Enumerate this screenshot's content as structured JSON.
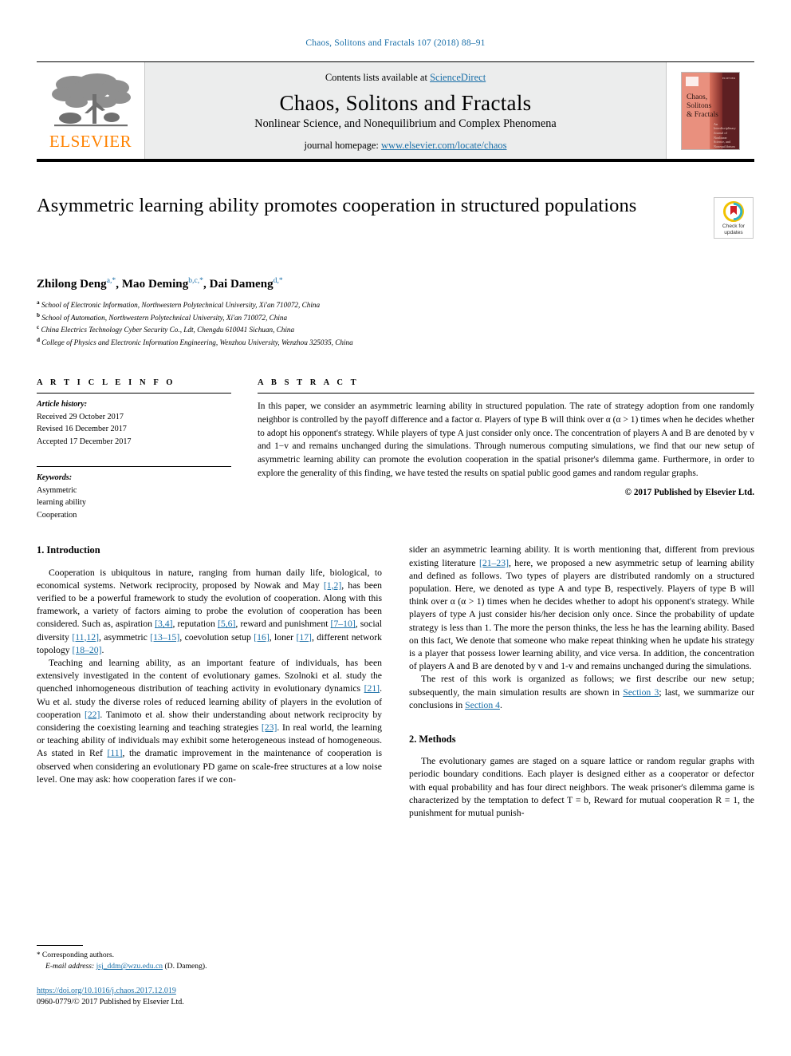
{
  "running_head": "Chaos, Solitons and Fractals 107 (2018) 88–91",
  "masthead": {
    "publisher_name": "ELSEVIER",
    "contents_prefix": "Contents lists available at ",
    "sciencedirect": "ScienceDirect",
    "journal_title": "Chaos, Solitons and Fractals",
    "journal_subtitle": "Nonlinear Science, and Nonequilibrium and Complex Phenomena",
    "homepage_prefix": "journal homepage: ",
    "homepage_url": "www.elsevier.com/locate/chaos",
    "cover": {
      "title_line1": "Chaos,",
      "title_line2": "Solitons",
      "title_line3": "& Fractals",
      "subtitle": "An Interdisciplinary Journal of Nonlinear Science, and Nonequilibrium and Complex Phenomena",
      "corner_label": "ELSEVIER"
    }
  },
  "article": {
    "title": "Asymmetric learning ability promotes cooperation in structured populations",
    "crossmark_line1": "Check for",
    "crossmark_line2": "updates",
    "authors": [
      {
        "name": "Zhilong Deng",
        "marks": "a,",
        "star": "*"
      },
      {
        "name": "Mao Deming",
        "marks": "b,c,",
        "star": "*"
      },
      {
        "name": "Dai Dameng",
        "marks": "d,",
        "star": "*"
      }
    ],
    "affiliations": [
      {
        "mark": "a",
        "text": "School of Electronic Information, Northwestern Polytechnical University, Xi'an 710072, China"
      },
      {
        "mark": "b",
        "text": "School of Automation, Northwestern Polytechnical University, Xi'an 710072, China"
      },
      {
        "mark": "c",
        "text": "China Electrics Technology Cyber Security Co., Ldt, Chengdu 610041 Sichuan, China"
      },
      {
        "mark": "d",
        "text": "College of Physics and Electronic Information Engineering, Wenzhou University, Wenzhou 325035, China"
      }
    ]
  },
  "article_info": {
    "heading": "A R T I C L E   I N F O",
    "history_label": "Article history:",
    "history": [
      "Received 29 October 2017",
      "Revised 16 December 2017",
      "Accepted 17 December 2017"
    ],
    "keywords_label": "Keywords:",
    "keywords": [
      "Asymmetric",
      "learning ability",
      "Cooperation"
    ]
  },
  "abstract": {
    "heading": "A B S T R A C T",
    "text": "In this paper, we consider an asymmetric learning ability in structured population. The rate of strategy adoption from one randomly neighbor is controlled by the payoff difference and a factor α. Players of type B will think over α (α > 1) times when he decides whether to adopt his opponent's strategy. While players of type A just consider only once. The concentration of players A and B are denoted by v and 1−v and remains unchanged during the simulations. Through numerous computing simulations, we find that our new setup of asymmetric learning ability can promote the evolution cooperation in the spatial prisoner's dilemma game. Furthermore, in order to explore the generality of this finding, we have tested the results on spatial public good games and random regular graphs.",
    "copyright": "© 2017 Published by Elsevier Ltd."
  },
  "body": {
    "section1_heading": "1. Introduction",
    "section2_heading": "2. Methods",
    "left_p1_a": "Cooperation is ubiquitous in nature, ranging from human daily life, biological, to economical systems. Network reciprocity, proposed by Nowak and May ",
    "left_p1_ref1": "[1,2]",
    "left_p1_b": ", has been verified to be a powerful framework to study the evolution of cooperation. Along with this framework, a variety of factors aiming to probe the evolution of cooperation has been considered. Such as, aspiration ",
    "left_p1_ref2": "[3,4]",
    "left_p1_c": ", reputation ",
    "left_p1_ref3": "[5,6]",
    "left_p1_d": ", reward and punishment ",
    "left_p1_ref4": "[7–10]",
    "left_p1_e": ", social diversity ",
    "left_p1_ref5": "[11,12]",
    "left_p1_f": ", asymmetric ",
    "left_p1_ref6": "[13–15]",
    "left_p1_g": ", coevolution setup ",
    "left_p1_ref7": "[16]",
    "left_p1_h": ", loner ",
    "left_p1_ref8": "[17]",
    "left_p1_i": ", different network topology ",
    "left_p1_ref9": "[18–20]",
    "left_p1_j": ".",
    "left_p2_a": "Teaching and learning ability, as an important feature of individuals, has been extensively investigated in the content of evolutionary games. Szolnoki et al. study the quenched inhomogeneous distribution of teaching activity in evolutionary dynamics ",
    "left_p2_ref1": "[21]",
    "left_p2_b": ". Wu et al. study the diverse roles of reduced learning ability of players in the evolution of cooperation ",
    "left_p2_ref2": "[22]",
    "left_p2_c": ". Tanimoto et al. show their understanding about network reciprocity by considering the coexisting learning and teaching strategies ",
    "left_p2_ref3": "[23]",
    "left_p2_d": ". In real world, the learning or teaching ability of individuals may exhibit some heterogeneous instead of homogeneous. As stated in Ref ",
    "left_p2_ref4": "[11]",
    "left_p2_e": ", the dramatic improvement in the maintenance of cooperation is observed when considering an evolutionary PD game on scale-free structures at a low noise level. One may ask: how cooperation fares if we con-",
    "right_p1_a": "sider an asymmetric learning ability. It is worth mentioning that, different from previous existing literature ",
    "right_p1_ref1": "[21–23]",
    "right_p1_b": ", here, we proposed a new asymmetric setup of learning ability and defined as follows. Two types of players are distributed randomly on a structured population. Here, we denoted as type A and type B, respectively. Players of type B will think over α (α > 1) times when he decides whether to adopt his opponent's strategy. While players of type A just consider his/her decision only once. Since the probability of update strategy is less than 1. The more the person thinks, the less he has the learning ability. Based on this fact, We denote that someone who make repeat thinking when he update his strategy is a player that possess lower learning ability, and vice versa. In addition, the concentration of players A and B are denoted by v and 1-v and remains unchanged during the simulations.",
    "right_p2_a": "The rest of this work is organized as follows; we first describe our new setup; subsequently, the main simulation results are shown in ",
    "right_p2_link1": "Section 3",
    "right_p2_b": "; last, we summarize our conclusions in ",
    "right_p2_link2": "Section 4",
    "right_p2_c": ".",
    "right_p3": "The evolutionary games are staged on a square lattice or random regular graphs with periodic boundary conditions. Each player is designed either as a cooperator or defector with equal probability and has four direct neighbors. The weak prisoner's dilemma game is characterized by the temptation to defect T = b, Reward for mutual cooperation R = 1, the punishment for mutual punish-"
  },
  "footnote": {
    "corresponding": "Corresponding authors.",
    "email_label": "E-mail address: ",
    "email": "jsj_ddm@wzu.edu.cn",
    "email_owner": " (D. Dameng).",
    "doi": "https://doi.org/10.1016/j.chaos.2017.12.019",
    "issn_line": "0960-0779/© 2017 Published by Elsevier Ltd."
  },
  "colors": {
    "link": "#1a6fa8",
    "elsevier_orange": "#ff8200",
    "masthead_bg": "#eceded"
  }
}
